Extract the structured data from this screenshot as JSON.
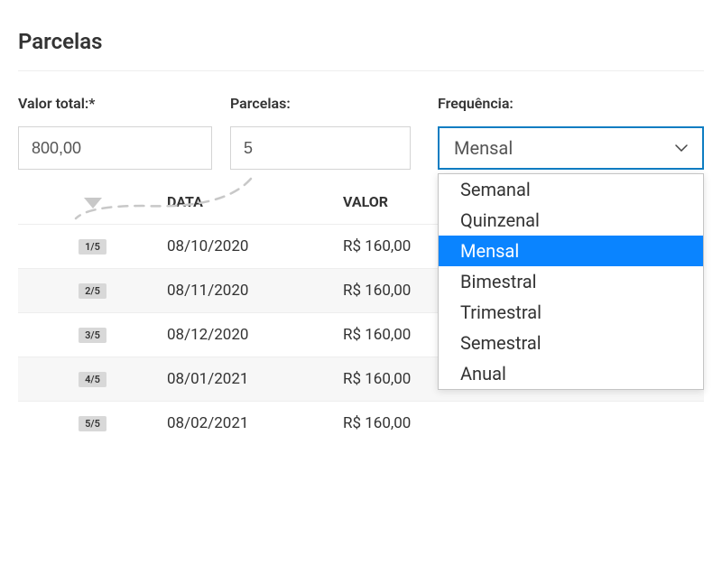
{
  "title": "Parcelas",
  "form": {
    "valor_label": "Valor total:*",
    "valor_value": "800,00",
    "parcelas_label": "Parcelas:",
    "parcelas_value": "5",
    "freq_label": "Frequência:",
    "freq_selected": "Mensal",
    "freq_options": [
      "Semanal",
      "Quinzenal",
      "Mensal",
      "Bimestral",
      "Trimestral",
      "Semestral",
      "Anual"
    ]
  },
  "table": {
    "header_data": "DATA",
    "header_valor": "VALOR",
    "rows": [
      {
        "badge": "1/5",
        "date": "08/10/2020",
        "value": "R$ 160,00"
      },
      {
        "badge": "2/5",
        "date": "08/11/2020",
        "value": "R$ 160,00"
      },
      {
        "badge": "3/5",
        "date": "08/12/2020",
        "value": "R$ 160,00"
      },
      {
        "badge": "4/5",
        "date": "08/01/2021",
        "value": "R$ 160,00"
      },
      {
        "badge": "5/5",
        "date": "08/02/2021",
        "value": "R$ 160,00"
      }
    ]
  }
}
